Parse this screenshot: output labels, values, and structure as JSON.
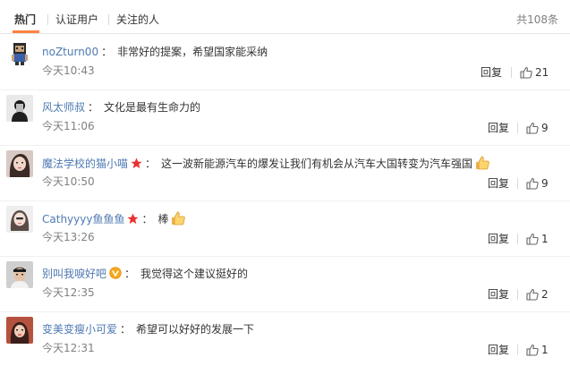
{
  "tabs": {
    "hot": "热门",
    "verified": "认证用户",
    "following": "关注的人",
    "total": "共108条"
  },
  "accent_color": "#ff8140",
  "link_color": "#4f7ab2",
  "comments": [
    {
      "username": "noZturn00",
      "badge": null,
      "text": "非常好的提案，希望国家能采纳",
      "emoji": null,
      "time": "今天10:43",
      "reply": "回复",
      "likes": "21",
      "avatar": "pixel-character-avatar"
    },
    {
      "username": "风太师叔",
      "badge": null,
      "text": "文化是最有生命力的",
      "emoji": null,
      "time": "今天11:06",
      "reply": "回复",
      "likes": "9",
      "avatar": "dark-portrait-avatar"
    },
    {
      "username": "魔法学校的猫小喵",
      "badge": "red-star-icon",
      "text": "这一波新能源汽车的爆发让我们有机会从汽车大国转变为汽车强国",
      "emoji": "thumbs-up-emoji",
      "time": "今天10:50",
      "reply": "回复",
      "likes": "9",
      "avatar": "girl-portrait-avatar"
    },
    {
      "username": "Cathyyyy鱼鱼鱼",
      "badge": "red-star-icon",
      "text": "棒",
      "emoji": "thumbs-up-emoji",
      "time": "今天13:26",
      "reply": "回复",
      "likes": "1",
      "avatar": "woman-portrait-avatar"
    },
    {
      "username": "别叫我唳好吧",
      "badge": "verified-v-icon",
      "text": "我觉得这个建议挺好的",
      "emoji": null,
      "time": "今天12:35",
      "reply": "回复",
      "likes": "2",
      "avatar": "man-portrait-avatar"
    },
    {
      "username": "变美变瘦小可爱",
      "badge": null,
      "text": "希望可以好好的发展一下",
      "emoji": null,
      "time": "今天12:31",
      "reply": "回复",
      "likes": "1",
      "avatar": "warm-portrait-avatar"
    }
  ]
}
